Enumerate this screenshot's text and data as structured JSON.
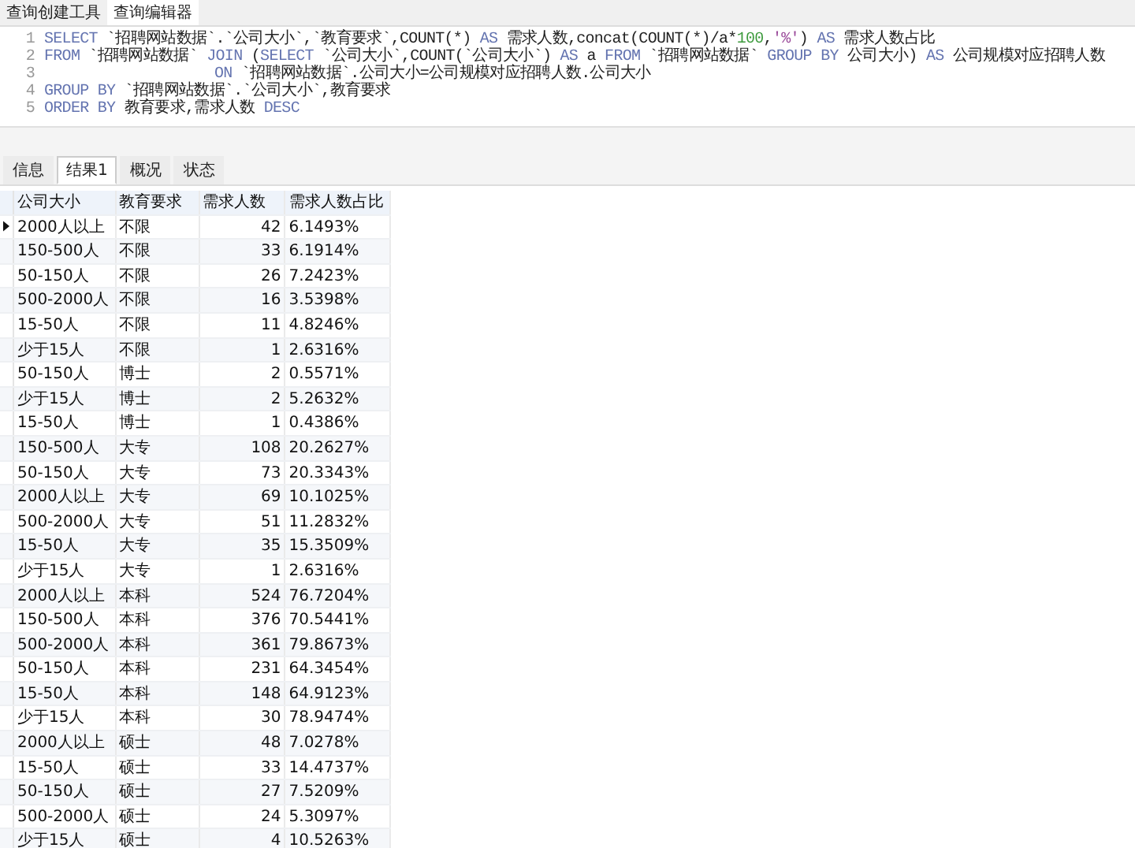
{
  "editor_tabs": [
    {
      "label": "查询创建工具",
      "selected": false
    },
    {
      "label": "查询编辑器",
      "selected": true
    }
  ],
  "sql_lines": [
    {
      "number": "1",
      "indented": false,
      "tokens": [
        {
          "kind": "kw",
          "text": "SELECT"
        },
        {
          "kind": "plain",
          "text": " `招聘网站数据`.`公司大小`,`教育要求`,COUNT(*) "
        },
        {
          "kind": "kw",
          "text": "AS"
        },
        {
          "kind": "plain",
          "text": " 需求人数,concat(COUNT(*)/a*"
        },
        {
          "kind": "num",
          "text": "100"
        },
        {
          "kind": "plain",
          "text": ","
        },
        {
          "kind": "str",
          "text": "'%'"
        },
        {
          "kind": "plain",
          "text": ") "
        },
        {
          "kind": "kw",
          "text": "AS"
        },
        {
          "kind": "plain",
          "text": " 需求人数占比"
        }
      ]
    },
    {
      "number": "2",
      "indented": false,
      "tokens": [
        {
          "kind": "kw",
          "text": "FROM"
        },
        {
          "kind": "plain",
          "text": " `招聘网站数据` "
        },
        {
          "kind": "kw",
          "text": "JOIN"
        },
        {
          "kind": "plain",
          "text": " ("
        },
        {
          "kind": "kw",
          "text": "SELECT"
        },
        {
          "kind": "plain",
          "text": " `公司大小`,COUNT(`公司大小`) "
        },
        {
          "kind": "kw",
          "text": "AS"
        },
        {
          "kind": "plain",
          "text": " a "
        },
        {
          "kind": "kw",
          "text": "FROM"
        },
        {
          "kind": "plain",
          "text": " `招聘网站数据` "
        },
        {
          "kind": "kw",
          "text": "GROUP BY"
        },
        {
          "kind": "plain",
          "text": " 公司大小) "
        },
        {
          "kind": "kw",
          "text": "AS"
        },
        {
          "kind": "plain",
          "text": " 公司规模对应招聘人数"
        }
      ]
    },
    {
      "number": "3",
      "indented": true,
      "tokens": [
        {
          "kind": "kw",
          "text": "ON"
        },
        {
          "kind": "plain",
          "text": " `招聘网站数据`.公司大小=公司规模对应招聘人数.公司大小"
        }
      ]
    },
    {
      "number": "4",
      "indented": false,
      "tokens": [
        {
          "kind": "kw",
          "text": "GROUP BY"
        },
        {
          "kind": "plain",
          "text": " `招聘网站数据`.`公司大小`,教育要求"
        }
      ]
    },
    {
      "number": "5",
      "indented": false,
      "tokens": [
        {
          "kind": "kw",
          "text": "ORDER BY"
        },
        {
          "kind": "plain",
          "text": " 教育要求,需求人数 "
        },
        {
          "kind": "kw",
          "text": "DESC"
        }
      ]
    }
  ],
  "result_tabs": [
    {
      "label": "信息",
      "selected": false
    },
    {
      "label": "结果1",
      "selected": true
    },
    {
      "label": "概况",
      "selected": false
    },
    {
      "label": "状态",
      "selected": false
    }
  ],
  "table": {
    "columns": [
      "公司大小",
      "教育要求",
      "需求人数",
      "需求人数占比"
    ],
    "rows": [
      {
        "current": true,
        "cells": [
          "2000人以上",
          "不限",
          "42",
          "6.1493%"
        ]
      },
      {
        "current": false,
        "cells": [
          "150-500人",
          "不限",
          "33",
          "6.1914%"
        ]
      },
      {
        "current": false,
        "cells": [
          "50-150人",
          "不限",
          "26",
          "7.2423%"
        ]
      },
      {
        "current": false,
        "cells": [
          "500-2000人",
          "不限",
          "16",
          "3.5398%"
        ]
      },
      {
        "current": false,
        "cells": [
          "15-50人",
          "不限",
          "11",
          "4.8246%"
        ]
      },
      {
        "current": false,
        "cells": [
          "少于15人",
          "不限",
          "1",
          "2.6316%"
        ]
      },
      {
        "current": false,
        "cells": [
          "50-150人",
          "博士",
          "2",
          "0.5571%"
        ]
      },
      {
        "current": false,
        "cells": [
          "少于15人",
          "博士",
          "2",
          "5.2632%"
        ]
      },
      {
        "current": false,
        "cells": [
          "15-50人",
          "博士",
          "1",
          "0.4386%"
        ]
      },
      {
        "current": false,
        "cells": [
          "150-500人",
          "大专",
          "108",
          "20.2627%"
        ]
      },
      {
        "current": false,
        "cells": [
          "50-150人",
          "大专",
          "73",
          "20.3343%"
        ]
      },
      {
        "current": false,
        "cells": [
          "2000人以上",
          "大专",
          "69",
          "10.1025%"
        ]
      },
      {
        "current": false,
        "cells": [
          "500-2000人",
          "大专",
          "51",
          "11.2832%"
        ]
      },
      {
        "current": false,
        "cells": [
          "15-50人",
          "大专",
          "35",
          "15.3509%"
        ]
      },
      {
        "current": false,
        "cells": [
          "少于15人",
          "大专",
          "1",
          "2.6316%"
        ]
      },
      {
        "current": false,
        "cells": [
          "2000人以上",
          "本科",
          "524",
          "76.7204%"
        ]
      },
      {
        "current": false,
        "cells": [
          "150-500人",
          "本科",
          "376",
          "70.5441%"
        ]
      },
      {
        "current": false,
        "cells": [
          "500-2000人",
          "本科",
          "361",
          "79.8673%"
        ]
      },
      {
        "current": false,
        "cells": [
          "50-150人",
          "本科",
          "231",
          "64.3454%"
        ]
      },
      {
        "current": false,
        "cells": [
          "15-50人",
          "本科",
          "148",
          "64.9123%"
        ]
      },
      {
        "current": false,
        "cells": [
          "少于15人",
          "本科",
          "30",
          "78.9474%"
        ]
      },
      {
        "current": false,
        "cells": [
          "2000人以上",
          "硕士",
          "48",
          "7.0278%"
        ]
      },
      {
        "current": false,
        "cells": [
          "15-50人",
          "硕士",
          "33",
          "14.4737%"
        ]
      },
      {
        "current": false,
        "cells": [
          "50-150人",
          "硕士",
          "27",
          "7.5209%"
        ]
      },
      {
        "current": false,
        "cells": [
          "500-2000人",
          "硕士",
          "24",
          "5.3097%"
        ]
      },
      {
        "current": false,
        "cells": [
          "少于15人",
          "硕士",
          "4",
          "10.5263%"
        ]
      }
    ]
  }
}
